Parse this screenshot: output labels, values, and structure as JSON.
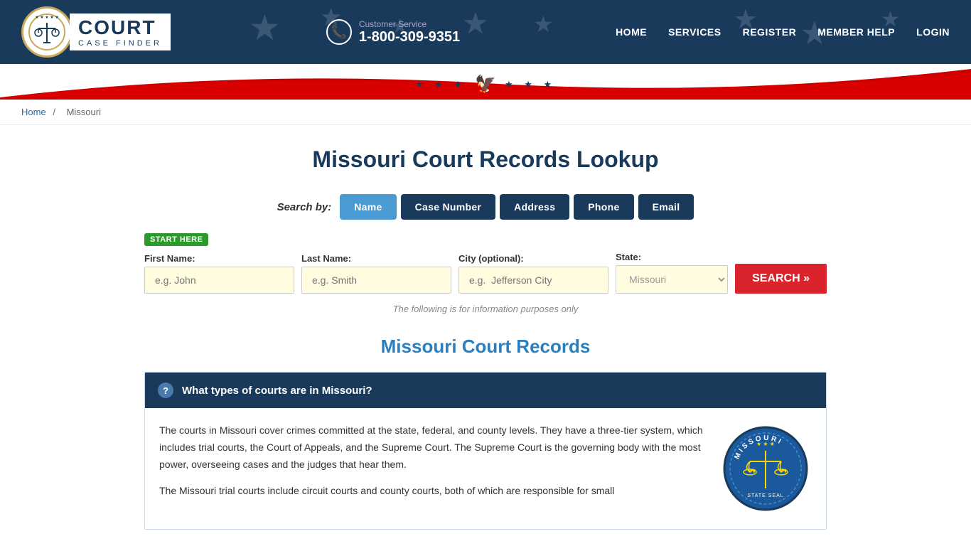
{
  "header": {
    "customer_service_label": "Customer Service",
    "phone": "1-800-309-9351",
    "nav": [
      "HOME",
      "SERVICES",
      "REGISTER",
      "MEMBER HELP",
      "LOGIN"
    ]
  },
  "breadcrumb": {
    "home_label": "Home",
    "separator": "/",
    "current": "Missouri"
  },
  "page": {
    "title": "Missouri Court Records Lookup"
  },
  "search": {
    "search_by_label": "Search by:",
    "tabs": [
      {
        "label": "Name",
        "active": true
      },
      {
        "label": "Case Number",
        "active": false
      },
      {
        "label": "Address",
        "active": false
      },
      {
        "label": "Phone",
        "active": false
      },
      {
        "label": "Email",
        "active": false
      }
    ],
    "start_here": "START HERE",
    "fields": {
      "first_name_label": "First Name:",
      "first_name_placeholder": "e.g. John",
      "last_name_label": "Last Name:",
      "last_name_placeholder": "e.g. Smith",
      "city_label": "City (optional):",
      "city_placeholder": "e.g.  Jefferson City",
      "state_label": "State:",
      "state_value": "Missouri"
    },
    "search_button": "SEARCH »",
    "info_note": "The following is for information purposes only"
  },
  "records_section": {
    "title": "Missouri Court Records",
    "faq": [
      {
        "question": "What types of courts are in Missouri?",
        "body_p1": "The courts in Missouri cover crimes committed at the state, federal, and county levels. They have a three-tier system, which includes trial courts, the Court of Appeals, and the Supreme Court. The Supreme Court is the governing body with the most power, overseeing cases and the judges that hear them.",
        "body_p2": "The Missouri trial courts include circuit courts and county courts, both of which are responsible for small"
      }
    ]
  },
  "icons": {
    "question_mark": "?",
    "phone_icon": "📞"
  }
}
